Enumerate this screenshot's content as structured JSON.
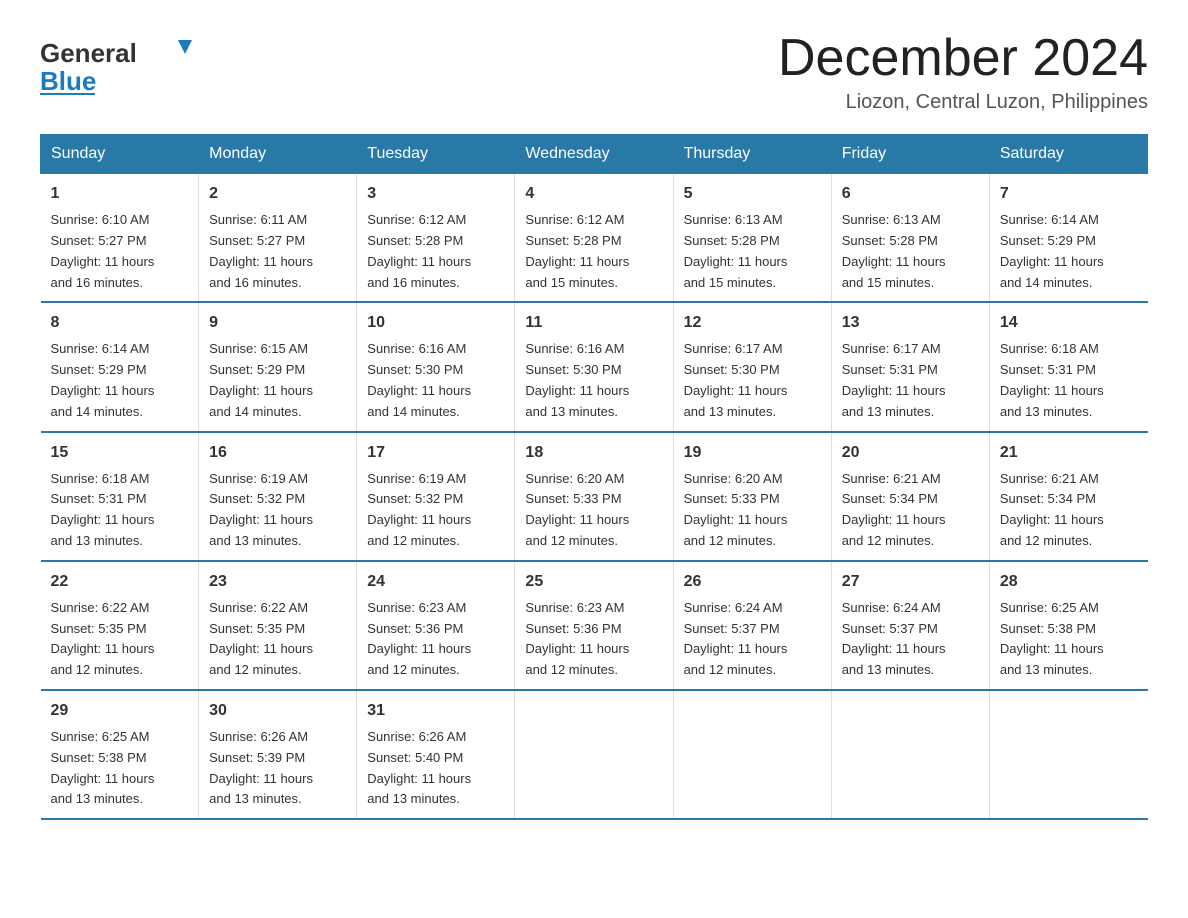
{
  "header": {
    "logo_general": "General",
    "logo_blue": "Blue",
    "title": "December 2024",
    "location": "Liozon, Central Luzon, Philippines"
  },
  "days_of_week": [
    "Sunday",
    "Monday",
    "Tuesday",
    "Wednesday",
    "Thursday",
    "Friday",
    "Saturday"
  ],
  "weeks": [
    [
      {
        "day": "1",
        "sunrise": "6:10 AM",
        "sunset": "5:27 PM",
        "daylight": "11 hours and 16 minutes."
      },
      {
        "day": "2",
        "sunrise": "6:11 AM",
        "sunset": "5:27 PM",
        "daylight": "11 hours and 16 minutes."
      },
      {
        "day": "3",
        "sunrise": "6:12 AM",
        "sunset": "5:28 PM",
        "daylight": "11 hours and 16 minutes."
      },
      {
        "day": "4",
        "sunrise": "6:12 AM",
        "sunset": "5:28 PM",
        "daylight": "11 hours and 15 minutes."
      },
      {
        "day": "5",
        "sunrise": "6:13 AM",
        "sunset": "5:28 PM",
        "daylight": "11 hours and 15 minutes."
      },
      {
        "day": "6",
        "sunrise": "6:13 AM",
        "sunset": "5:28 PM",
        "daylight": "11 hours and 15 minutes."
      },
      {
        "day": "7",
        "sunrise": "6:14 AM",
        "sunset": "5:29 PM",
        "daylight": "11 hours and 14 minutes."
      }
    ],
    [
      {
        "day": "8",
        "sunrise": "6:14 AM",
        "sunset": "5:29 PM",
        "daylight": "11 hours and 14 minutes."
      },
      {
        "day": "9",
        "sunrise": "6:15 AM",
        "sunset": "5:29 PM",
        "daylight": "11 hours and 14 minutes."
      },
      {
        "day": "10",
        "sunrise": "6:16 AM",
        "sunset": "5:30 PM",
        "daylight": "11 hours and 14 minutes."
      },
      {
        "day": "11",
        "sunrise": "6:16 AM",
        "sunset": "5:30 PM",
        "daylight": "11 hours and 13 minutes."
      },
      {
        "day": "12",
        "sunrise": "6:17 AM",
        "sunset": "5:30 PM",
        "daylight": "11 hours and 13 minutes."
      },
      {
        "day": "13",
        "sunrise": "6:17 AM",
        "sunset": "5:31 PM",
        "daylight": "11 hours and 13 minutes."
      },
      {
        "day": "14",
        "sunrise": "6:18 AM",
        "sunset": "5:31 PM",
        "daylight": "11 hours and 13 minutes."
      }
    ],
    [
      {
        "day": "15",
        "sunrise": "6:18 AM",
        "sunset": "5:31 PM",
        "daylight": "11 hours and 13 minutes."
      },
      {
        "day": "16",
        "sunrise": "6:19 AM",
        "sunset": "5:32 PM",
        "daylight": "11 hours and 13 minutes."
      },
      {
        "day": "17",
        "sunrise": "6:19 AM",
        "sunset": "5:32 PM",
        "daylight": "11 hours and 12 minutes."
      },
      {
        "day": "18",
        "sunrise": "6:20 AM",
        "sunset": "5:33 PM",
        "daylight": "11 hours and 12 minutes."
      },
      {
        "day": "19",
        "sunrise": "6:20 AM",
        "sunset": "5:33 PM",
        "daylight": "11 hours and 12 minutes."
      },
      {
        "day": "20",
        "sunrise": "6:21 AM",
        "sunset": "5:34 PM",
        "daylight": "11 hours and 12 minutes."
      },
      {
        "day": "21",
        "sunrise": "6:21 AM",
        "sunset": "5:34 PM",
        "daylight": "11 hours and 12 minutes."
      }
    ],
    [
      {
        "day": "22",
        "sunrise": "6:22 AM",
        "sunset": "5:35 PM",
        "daylight": "11 hours and 12 minutes."
      },
      {
        "day": "23",
        "sunrise": "6:22 AM",
        "sunset": "5:35 PM",
        "daylight": "11 hours and 12 minutes."
      },
      {
        "day": "24",
        "sunrise": "6:23 AM",
        "sunset": "5:36 PM",
        "daylight": "11 hours and 12 minutes."
      },
      {
        "day": "25",
        "sunrise": "6:23 AM",
        "sunset": "5:36 PM",
        "daylight": "11 hours and 12 minutes."
      },
      {
        "day": "26",
        "sunrise": "6:24 AM",
        "sunset": "5:37 PM",
        "daylight": "11 hours and 12 minutes."
      },
      {
        "day": "27",
        "sunrise": "6:24 AM",
        "sunset": "5:37 PM",
        "daylight": "11 hours and 13 minutes."
      },
      {
        "day": "28",
        "sunrise": "6:25 AM",
        "sunset": "5:38 PM",
        "daylight": "11 hours and 13 minutes."
      }
    ],
    [
      {
        "day": "29",
        "sunrise": "6:25 AM",
        "sunset": "5:38 PM",
        "daylight": "11 hours and 13 minutes."
      },
      {
        "day": "30",
        "sunrise": "6:26 AM",
        "sunset": "5:39 PM",
        "daylight": "11 hours and 13 minutes."
      },
      {
        "day": "31",
        "sunrise": "6:26 AM",
        "sunset": "5:40 PM",
        "daylight": "11 hours and 13 minutes."
      },
      {
        "day": "",
        "sunrise": "",
        "sunset": "",
        "daylight": ""
      },
      {
        "day": "",
        "sunrise": "",
        "sunset": "",
        "daylight": ""
      },
      {
        "day": "",
        "sunrise": "",
        "sunset": "",
        "daylight": ""
      },
      {
        "day": "",
        "sunrise": "",
        "sunset": "",
        "daylight": ""
      }
    ]
  ],
  "labels": {
    "sunrise": "Sunrise:",
    "sunset": "Sunset:",
    "daylight": "Daylight:"
  },
  "colors": {
    "header_bg": "#2878a8",
    "header_text": "#ffffff",
    "border": "#2878a8"
  }
}
